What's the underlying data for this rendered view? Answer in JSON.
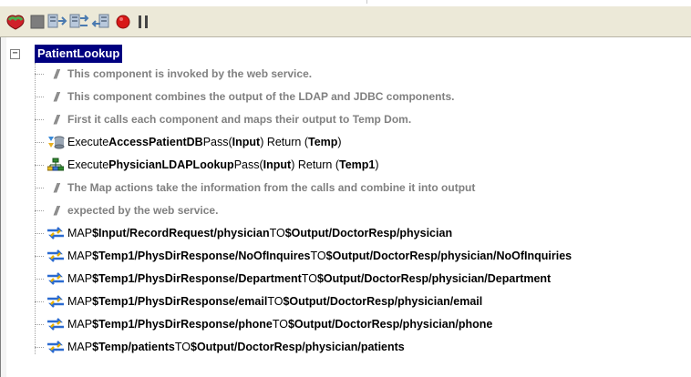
{
  "toolbar": {
    "buttons": [
      {
        "name": "run-icon",
        "color": "#3a9a3a"
      },
      {
        "name": "stop-icon",
        "color": "#808080"
      },
      {
        "name": "step-into-icon",
        "color": "#4a7ab0"
      },
      {
        "name": "step-over-icon",
        "color": "#4a7ab0"
      },
      {
        "name": "step-out-icon",
        "color": "#4a7ab0"
      },
      {
        "name": "breakpoint-icon",
        "color": "#d01010"
      },
      {
        "name": "pause-icon",
        "color": "#404040"
      }
    ]
  },
  "tree": {
    "root_label": "PatientLookup",
    "expander": "−",
    "rows": [
      {
        "kind": "comment",
        "text": "This component is invoked by the web service."
      },
      {
        "kind": "comment",
        "text": "This component combines the output of the LDAP and JDBC components."
      },
      {
        "kind": "comment",
        "text": "First it calls each component and maps their output to Temp Dom."
      },
      {
        "kind": "execute",
        "icon": "database-icon",
        "prefix": "Execute ",
        "name": "AccessPatientDB",
        "pass_label": " Pass(",
        "pass": "Input",
        "ret_label": ") Return (",
        "ret": "Temp",
        "end": ")"
      },
      {
        "kind": "execute",
        "icon": "ldap-network-icon",
        "prefix": "Execute ",
        "name": "PhysicianLDAPLookup",
        "pass_label": " Pass(",
        "pass": "Input",
        "ret_label": ") Return (",
        "ret": "Temp1",
        "end": ")"
      },
      {
        "kind": "comment",
        "text": "The Map actions take the information from the calls and combine it into output"
      },
      {
        "kind": "comment",
        "text": "expected by the web service."
      },
      {
        "kind": "map",
        "prefix": "MAP ",
        "src": "$Input/RecordRequest/physician",
        "to": " TO ",
        "dst": "$Output/DoctorResp/physician"
      },
      {
        "kind": "map",
        "prefix": "MAP ",
        "src": "$Temp1/PhysDirResponse/NoOfInquires",
        "to": " TO ",
        "dst": "$Output/DoctorResp/physician/NoOfInquiries"
      },
      {
        "kind": "map",
        "prefix": "MAP ",
        "src": "$Temp1/PhysDirResponse/Department",
        "to": " TO ",
        "dst": "$Output/DoctorResp/physician/Department"
      },
      {
        "kind": "map",
        "prefix": "MAP ",
        "src": "$Temp1/PhysDirResponse/email",
        "to": " TO ",
        "dst": "$Output/DoctorResp/physician/email"
      },
      {
        "kind": "map",
        "prefix": "MAP ",
        "src": "$Temp1/PhysDirResponse/phone",
        "to": " TO ",
        "dst": "$Output/DoctorResp/physician/phone"
      },
      {
        "kind": "map",
        "prefix": "MAP ",
        "src": "$Temp/patients",
        "to": " TO ",
        "dst": "$Output/DoctorResp/physician/patients"
      }
    ],
    "comment_glyph": "//"
  }
}
